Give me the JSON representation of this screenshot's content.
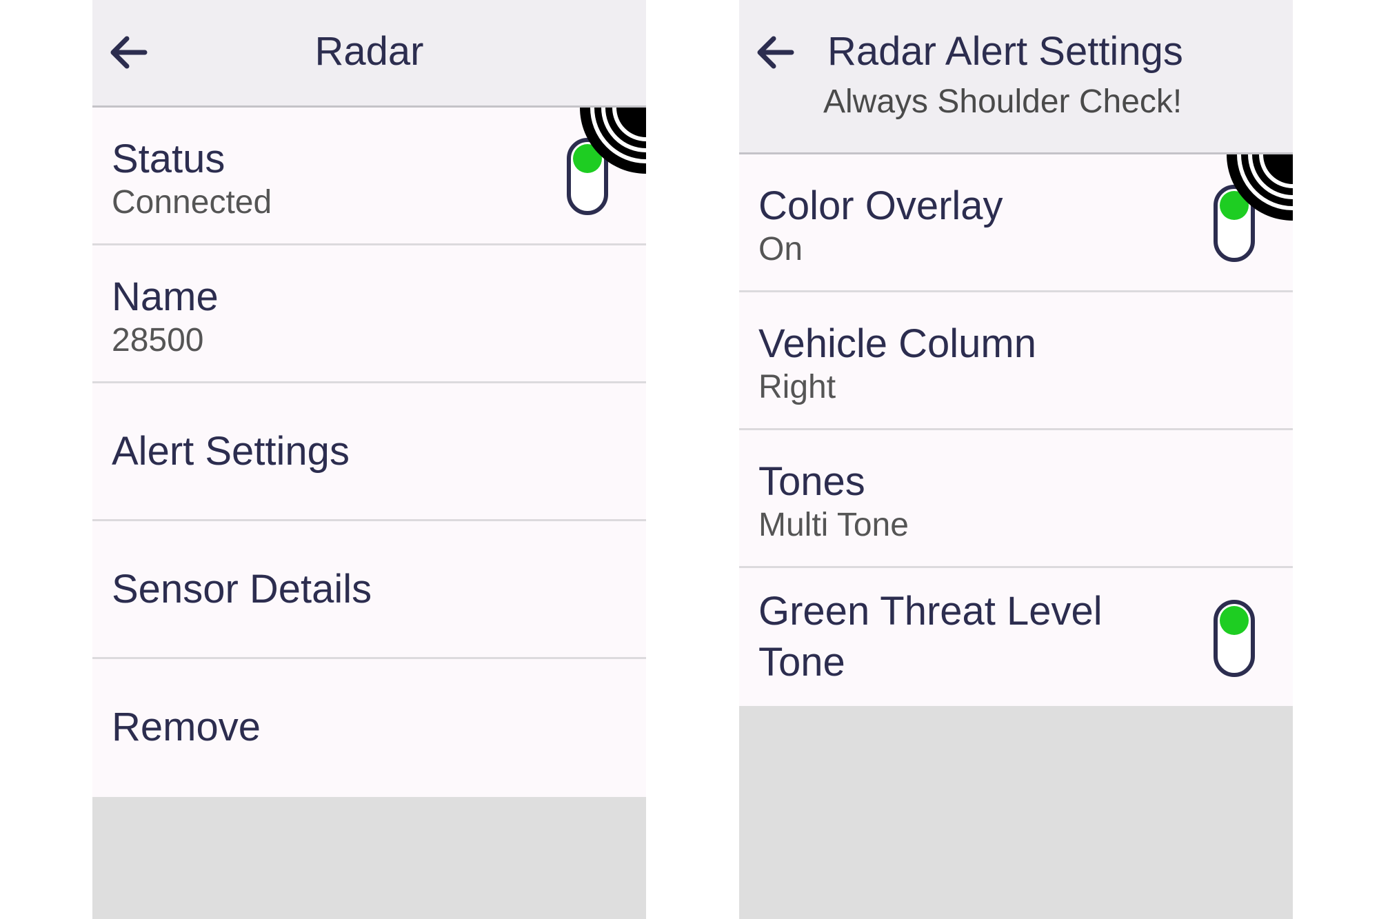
{
  "colors": {
    "header_bg": "#f0eef2",
    "row_bg": "#fdf9fc",
    "text_primary": "#2c2d4f",
    "text_secondary": "#555555",
    "toggle_on": "#1ecd22",
    "empty_area": "#dedede"
  },
  "radar_screen": {
    "header": {
      "back_icon": "arrow-left-icon",
      "title": "Radar"
    },
    "rows": [
      {
        "label": "Status",
        "value": "Connected",
        "toggle_on": true
      },
      {
        "label": "Name",
        "value": "28500"
      },
      {
        "label": "Alert Settings"
      },
      {
        "label": "Sensor Details"
      },
      {
        "label": "Remove"
      }
    ],
    "badge_icon": "radar-signal-icon"
  },
  "alert_screen": {
    "header": {
      "back_icon": "arrow-left-icon",
      "title": "Radar Alert Settings",
      "subtitle": "Always Shoulder Check!"
    },
    "rows": [
      {
        "label": "Color Overlay",
        "value": "On",
        "toggle_on": true
      },
      {
        "label": "Vehicle Column",
        "value": "Right"
      },
      {
        "label": "Tones",
        "value": "Multi Tone"
      },
      {
        "label": "Green Threat Level Tone",
        "toggle_on": true
      }
    ],
    "badge_icon": "radar-signal-icon"
  }
}
